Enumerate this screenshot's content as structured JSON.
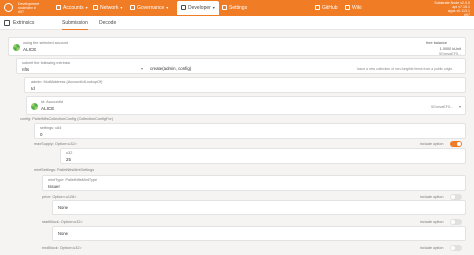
{
  "topbar": {
    "brand_line1": "Development",
    "brand_line2": "node/dev #",
    "brand_line3": "#97",
    "nav": [
      {
        "label": "Accounts"
      },
      {
        "label": "Network"
      },
      {
        "label": "Governance"
      },
      {
        "label": "Developer"
      },
      {
        "label": "Settings"
      },
      {
        "label": "GitHub"
      },
      {
        "label": "Wiki"
      }
    ],
    "node_line1": "Substrate Node v2.0.0",
    "node_line2": "api v7.15.1",
    "node_line3": "apps v0.113.1",
    "node_line4": "#97"
  },
  "tabs": {
    "main": "Extrinsics",
    "items": [
      "Submission",
      "Decode"
    ]
  },
  "form": {
    "account_label": "using the selected account",
    "account_name": "ALICE",
    "free_balance_label": "free balance",
    "free_balance_value": "1.0000 kUnit",
    "account_address": "5GrwvaEF5...",
    "submit_label": "submit the following extrinsic",
    "pallet": "nfts",
    "call": "create(admin, config)",
    "call_hint": "Issue a new collection of non-fungible items from a public origin.",
    "admin_label": "admin: MultiAddress (AccountIdLookupOf)",
    "admin_type": "Id",
    "accountid_label": "Id: AccountId",
    "accountid_name": "ALICE",
    "accountid_address": "5GrwvaEF5...",
    "config_label": "config: PalletNftsCollectionConfig (CollectionConfigFor)",
    "settings_label": "settings: u64",
    "settings_value": "0",
    "maxsupply_label": "maxSupply: Option<u32>",
    "maxsupply_include": "include option",
    "u32_label": "u32",
    "u32_value": "25",
    "mintsettings_label": "mintSettings: PalletNftsMintSettings",
    "minttype_label": "mintType: PalletNftsMintType",
    "minttype_value": "Issuer",
    "price_label": "price: Option<u128>",
    "price_include": "include option",
    "price_none": "None",
    "startblock_label": "startBlock: Option<u32>",
    "startblock_include": "include option",
    "startblock_none": "None",
    "endblock_label": "endBlock: Option<u32>",
    "endblock_include": "include option"
  },
  "colors": {
    "accent": "#f07c26"
  }
}
